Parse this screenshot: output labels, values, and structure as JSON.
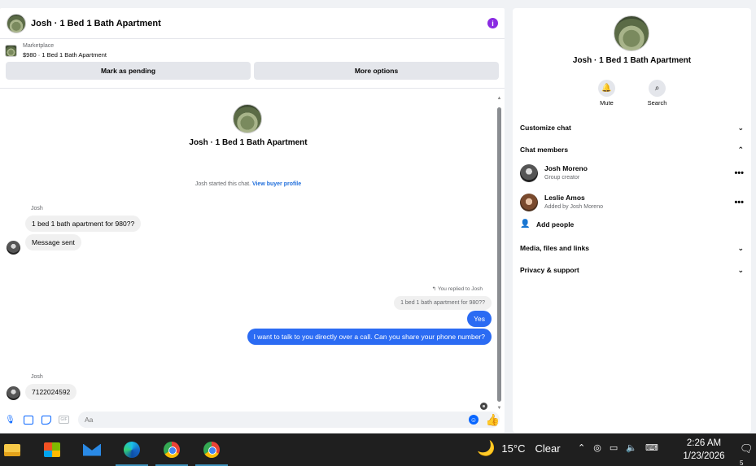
{
  "chat": {
    "title": "Josh · 1 Bed 1 Bath Apartment",
    "info_icon": "i",
    "marketplace_label": "Marketplace",
    "listing": "$980 · 1 Bed 1 Bath Apartment",
    "mark_pending": "Mark as pending",
    "more_options": "More options",
    "thread_title": "Josh · 1 Bed 1 Bath Apartment",
    "started_text": "Josh started this chat.",
    "view_profile": "View buyer profile",
    "messages": {
      "sender1": "Josh",
      "msg1": "1 bed 1 bath apartment for 980??",
      "msg2": "Message sent",
      "replied_to": "You replied to Josh",
      "quoted": "1 bed 1 bath apartment for 980??",
      "reply1": "Yes",
      "reply2": "I want to talk to you directly over a call. Can you share your phone number?",
      "sender2": "Josh",
      "msg3": "7122024592"
    },
    "composer_placeholder": "Aa",
    "gif_label": "GIF"
  },
  "info": {
    "title": "Josh · 1 Bed 1 Bath Apartment",
    "mute": "Mute",
    "search": "Search",
    "customize": "Customize chat",
    "members_header": "Chat members",
    "members": [
      {
        "name": "Josh Moreno",
        "role": "Group creator"
      },
      {
        "name": "Leslie Amos",
        "role": "Added by Josh Moreno"
      }
    ],
    "add_people": "Add people",
    "media": "Media, files and links",
    "privacy": "Privacy & support"
  },
  "taskbar": {
    "temperature": "15°C",
    "condition": "Clear",
    "time": "2:26 AM",
    "date": "1/23/2026",
    "notif_count": "5"
  },
  "colors": {
    "accent": "#0866ff",
    "outgoing_bubble": "#2b6bf3",
    "info_icon": "#8a2be2"
  }
}
